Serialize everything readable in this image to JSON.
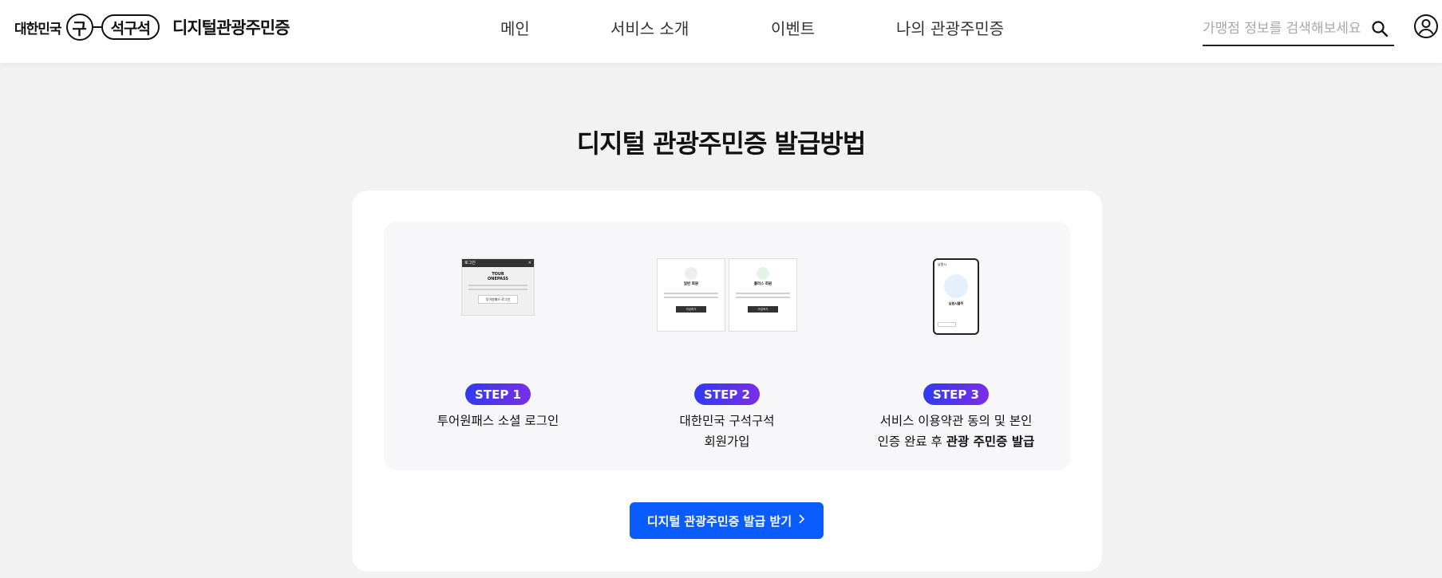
{
  "header": {
    "logo": {
      "country": "대한민국",
      "gu": "구",
      "pill": "석구석",
      "service": "디지털관광주민증"
    },
    "nav": [
      {
        "label": "메인"
      },
      {
        "label": "서비스 소개"
      },
      {
        "label": "이벤트"
      },
      {
        "label": "나의 관광주민증"
      }
    ],
    "search": {
      "placeholder": "가맹점 정보를 검색해보세요",
      "icon": "search-icon"
    },
    "user_icon": "user-icon"
  },
  "main": {
    "title": "디지털 관광주민증 발급방법",
    "steps": [
      {
        "badge": "STEP 1",
        "desc_lines": [
          "투어원패스 소셜 로그인"
        ],
        "thumb": {
          "bar": "로그인",
          "brand_top": "TOUR",
          "brand_bottom": "ONEPASS",
          "button": "투어원패스 로그인"
        }
      },
      {
        "badge": "STEP 2",
        "desc_lines": [
          "대한민국 구석구석",
          "회원가입"
        ],
        "thumb": {
          "card1": "일반 회원",
          "card2": "플러스 회원",
          "button": "가입하기"
        }
      },
      {
        "badge": "STEP 3",
        "desc_lines": [
          "서비스 이용약관 동의 및 본인",
          "인증 완료 후 "
        ],
        "desc_bold": "관광 주민증 발급",
        "thumb": {
          "top": "남원시",
          "name": "남원시뜰주"
        }
      }
    ],
    "cta": {
      "label": "디지털 관광주민증 발급 받기",
      "icon": "chevron-right-icon"
    }
  },
  "colors": {
    "accent": "#0a5cff",
    "badge_gradient_start": "#2f3bf0",
    "badge_gradient_end": "#7a2ee6",
    "page_background": "#f2f2f2"
  }
}
